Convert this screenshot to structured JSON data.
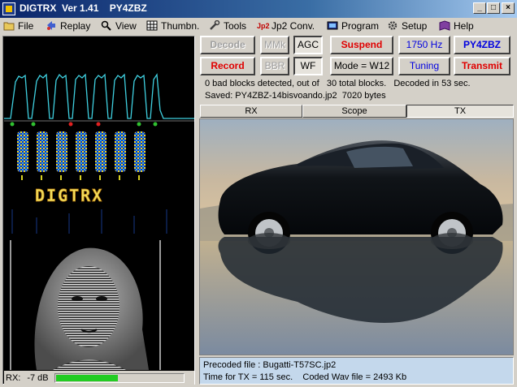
{
  "window": {
    "title": "DIGTRX  Ver 1.41    PY4ZBZ",
    "min": "_",
    "max": "□",
    "close": "×"
  },
  "menu": {
    "items": [
      {
        "label": "File",
        "icon": "folder-icon"
      },
      {
        "label": "Replay",
        "icon": "replay-icon"
      },
      {
        "label": "View",
        "icon": "magnifier-icon"
      },
      {
        "label": "Thumbn.",
        "icon": "grid-icon"
      },
      {
        "label": "Tools",
        "icon": "tools-icon"
      },
      {
        "label": "Jp2 Conv.",
        "icon": "jp2-icon"
      },
      {
        "label": "Program",
        "icon": "program-icon"
      },
      {
        "label": "Setup",
        "icon": "gear-icon"
      },
      {
        "label": "Help",
        "icon": "book-icon"
      }
    ]
  },
  "buttons": {
    "decode": "Decode",
    "mmk": "MMk",
    "agc": "AGC",
    "suspend": "Suspend",
    "freq": "1750 Hz",
    "callsign": "PY4ZBZ",
    "record": "Record",
    "bbr": "BBR",
    "wf": "WF",
    "mode": "Mode = W12",
    "tuning": "Tuning",
    "transmit": "Transmit"
  },
  "info": {
    "line1": "0 bad blocks detected, out of   30 total blocks.   Decoded in 53 sec.",
    "line2": "Saved: PY4ZBZ-14bisvoando.jp2  7020 bytes"
  },
  "tabs": [
    "RX",
    "Scope",
    "TX"
  ],
  "active_tab": "TX",
  "spectro_logo": "DIGTRX",
  "rx": {
    "label": "RX:",
    "level": "-7 dB",
    "meter_fraction": 0.48
  },
  "status": {
    "line1": "Precoded file : Bugatti-T57SC.jp2",
    "line2": "Time for TX = 115 sec.    Coded Wav file = 2493 Kb"
  },
  "colors": {
    "scope": "#3fd0e0",
    "meter": "#22cc22",
    "record": "#e00000",
    "blue": "#0000e0"
  }
}
